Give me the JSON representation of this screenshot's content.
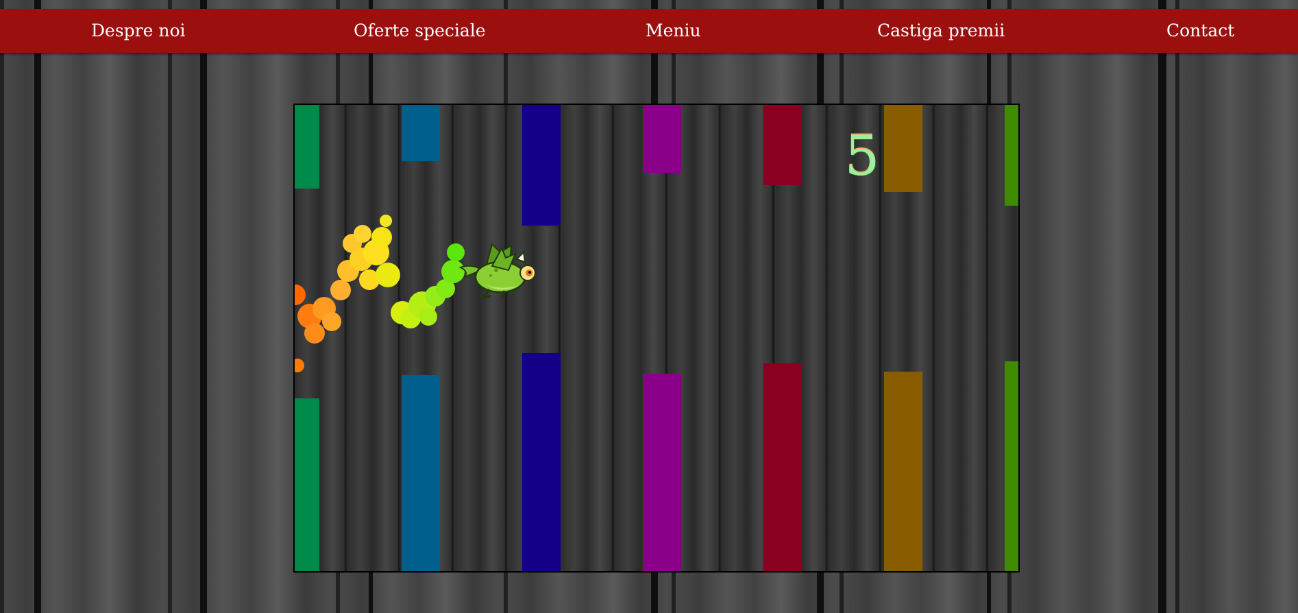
{
  "nav": {
    "items": [
      {
        "label": "Despre noi"
      },
      {
        "label": "Oferte speciale"
      },
      {
        "label": "Meniu"
      },
      {
        "label": "Castiga premii"
      },
      {
        "label": "Contact"
      }
    ]
  },
  "game": {
    "score": "5",
    "colors": {
      "nav_background": "#9b0f0f",
      "score": "#9cf0a0",
      "pillars": [
        "#008a4a",
        "#005f8c",
        "#140087",
        "#8a0088",
        "#8a0020",
        "#8a5c00",
        "#3f8a00"
      ]
    },
    "icons": {
      "player": "dragon-icon",
      "trail": "rainbow-trail"
    }
  }
}
